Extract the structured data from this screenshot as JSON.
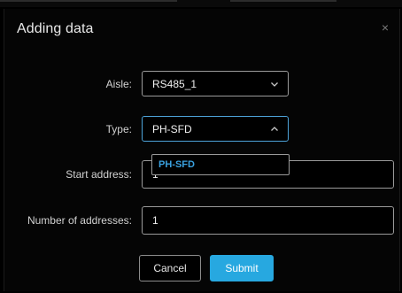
{
  "dialog": {
    "title": "Adding data",
    "close_glyph": "×",
    "close_icon": "close-icon"
  },
  "form": {
    "aisle": {
      "label": "Aisle:",
      "value": "RS485_1",
      "icon": "chevron-down-icon"
    },
    "type": {
      "label": "Type:",
      "value": "PH-SFD",
      "icon": "chevron-up-icon",
      "open": true,
      "options": [
        "PH-SFD"
      ]
    },
    "start_address": {
      "label": "Start address:",
      "value": "1"
    },
    "number_of_addresses": {
      "label": "Number of addresses:",
      "value": "1"
    }
  },
  "buttons": {
    "cancel_label": "Cancel",
    "submit_label": "Submit"
  },
  "colors": {
    "background": "#000000",
    "accent": "#27a8e0",
    "focus_border": "#4da3d9",
    "option_text": "#3aa1df"
  }
}
